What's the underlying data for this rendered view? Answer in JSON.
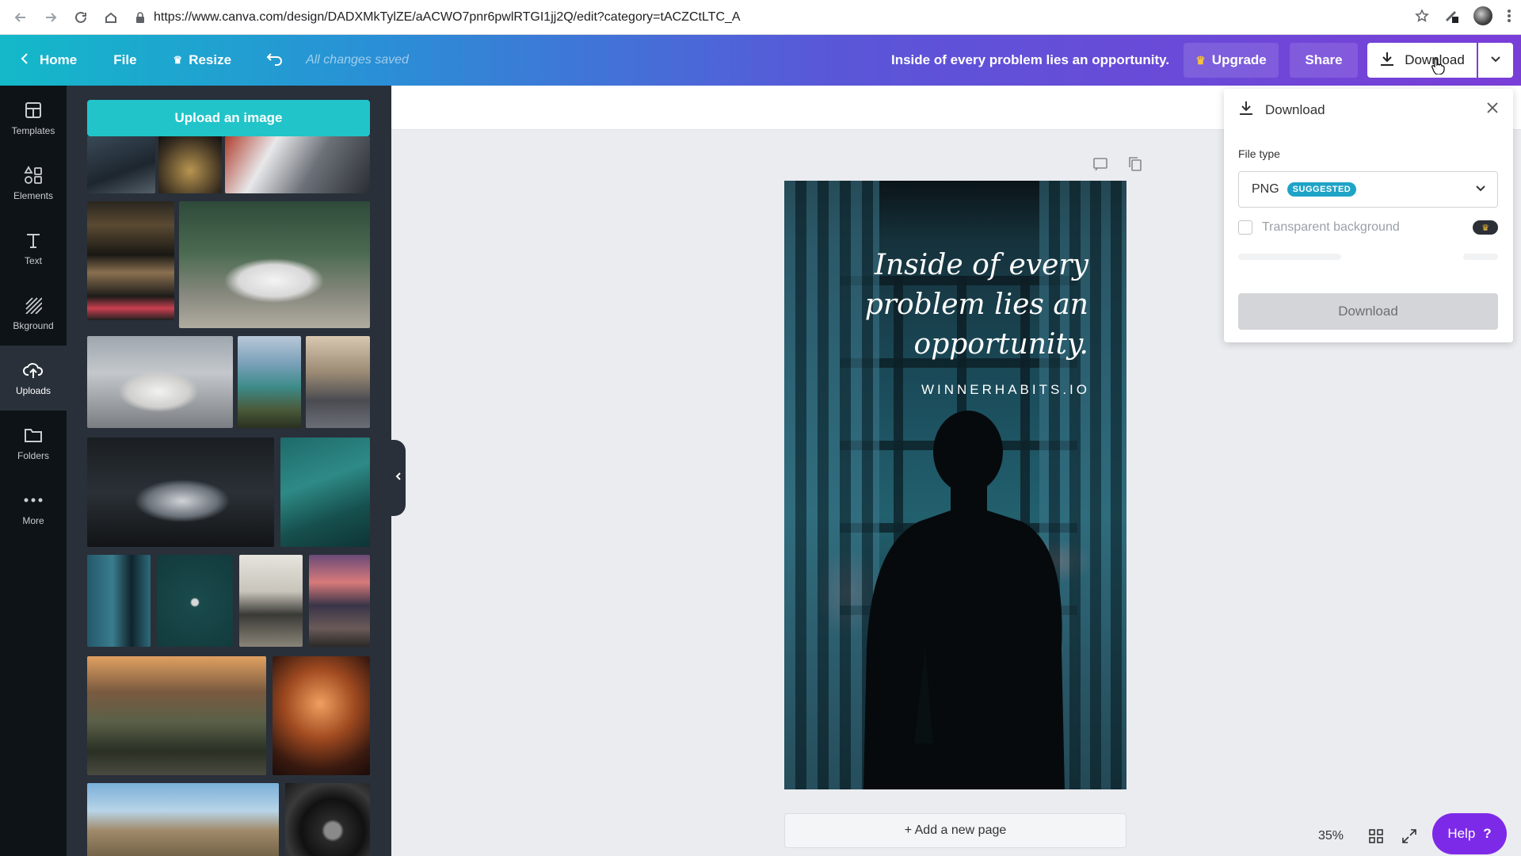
{
  "browser": {
    "url": "https://www.canva.com/design/DADXMkTylZE/aACWO7pnr6pwlRTGI1jj2Q/edit?category=tACZCtLTC_A"
  },
  "topbar": {
    "home_label": "Home",
    "file_label": "File",
    "resize_label": "Resize",
    "saved_status": "All changes saved",
    "design_title": "Inside of every problem lies an opportunity.",
    "upgrade_label": "Upgrade",
    "share_label": "Share",
    "download_label": "Download"
  },
  "rail": {
    "items": [
      {
        "label": "Templates",
        "icon": "templates-icon"
      },
      {
        "label": "Elements",
        "icon": "elements-icon"
      },
      {
        "label": "Text",
        "icon": "text-icon"
      },
      {
        "label": "Bkground",
        "icon": "background-icon"
      },
      {
        "label": "Uploads",
        "icon": "upload-cloud-icon"
      },
      {
        "label": "Folders",
        "icon": "folder-icon"
      },
      {
        "label": "More",
        "icon": "more-dots-icon"
      }
    ]
  },
  "uploads": {
    "upload_button_label": "Upload an image"
  },
  "design": {
    "quote_line1": "Inside of every",
    "quote_line2": "problem lies an",
    "quote_line3": "opportunity.",
    "brand": "WINNERHABITS.IO"
  },
  "canvas": {
    "add_page_label": "+ Add a new page",
    "zoom": "35%",
    "help_label": "Help",
    "help_glyph": "?"
  },
  "download_panel": {
    "title": "Download",
    "file_type_label": "File type",
    "file_type_value": "PNG",
    "suggested_badge": "SUGGESTED",
    "transparent_label": "Transparent background",
    "submit_label": "Download"
  },
  "colors": {
    "topbar_gradient_start": "#13b9c9",
    "topbar_gradient_end": "#7a3ed8",
    "upload_button": "#21c4c9",
    "help_button": "#7d2ae8",
    "panel_bg": "#293039",
    "rail_bg": "#0e1318"
  }
}
